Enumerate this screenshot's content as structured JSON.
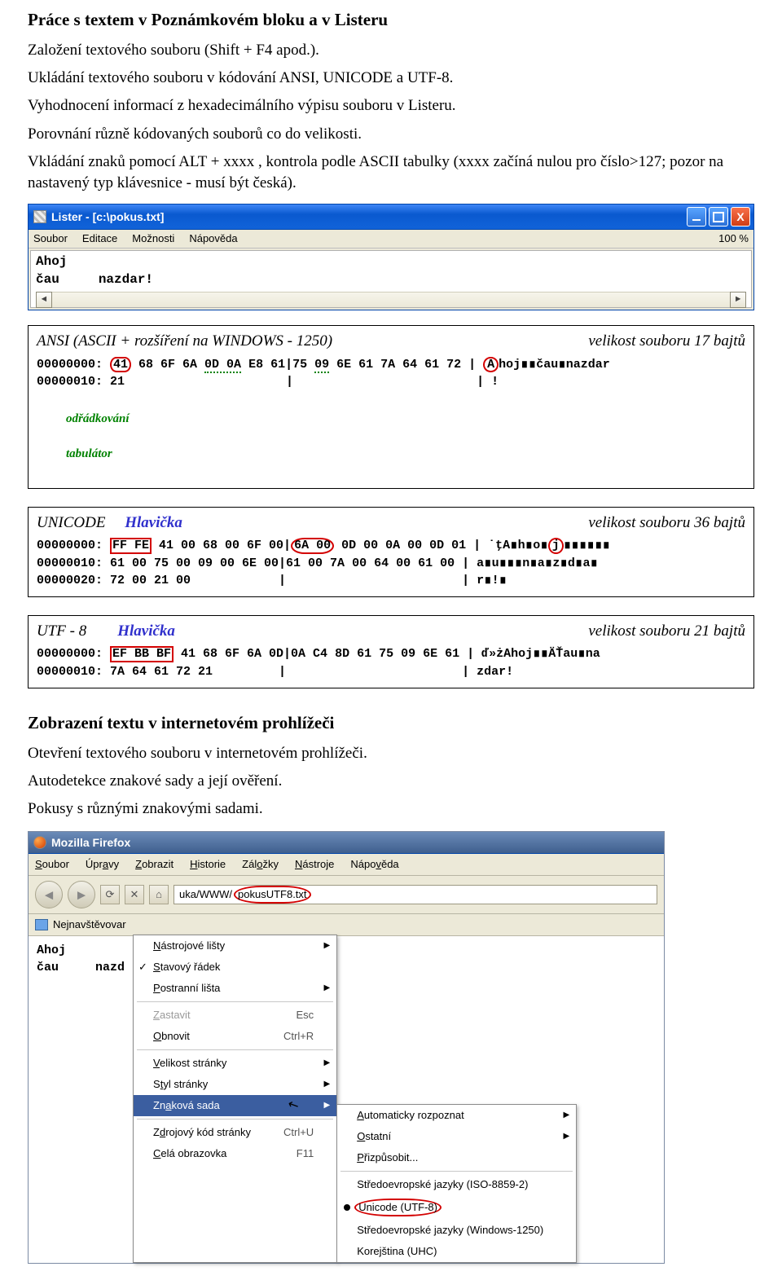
{
  "doc": {
    "heading": "Práce s textem v Poznámkovém bloku a v Listeru",
    "p1": "Založení textového souboru (Shift + F4 apod.).",
    "p2": "Ukládání textového souboru v kódování ANSI, UNICODE a UTF-8.",
    "p3": "Vyhodnocení informací z hexadecimálního výpisu souboru v Listeru.",
    "p4": "Porovnání různě kódovaných souborů co do velikosti.",
    "p5": "Vkládání znaků pomocí ALT + xxxx , kontrola podle ASCII tabulky (xxxx začíná nulou pro číslo>127; pozor na nastavený typ klávesnice - musí být česká).",
    "h2b": "Zobrazení textu v internetovém prohlížeči",
    "p6": "Otevření textového souboru v internetovém prohlížeči.",
    "p7": "Autodetekce znakové sady a její ověření.",
    "p8": "Pokusy s různými znakovými sadami."
  },
  "lister": {
    "title": "Lister - [c:\\pokus.txt]",
    "menu": [
      "Soubor",
      "Editace",
      "Možnosti",
      "Nápověda"
    ],
    "percent": "100 %",
    "line1": "Ahoj",
    "line2": "čau     nazdar!"
  },
  "annot": {
    "odr": "odřádkování",
    "tab": "tabulátor",
    "hlav": "Hlavička"
  },
  "ansi": {
    "title_left": "ANSI (ASCII + rozšíření na WINDOWS - 1250)",
    "title_right": "velikost souboru 17 bajtů",
    "l1_addr": "00000000: ",
    "l1_41": "41",
    "l1_a": " 68 6F 6A ",
    "l1_odr": "0D 0A",
    "l1_b": " E8 61|75 ",
    "l1_tab": "09",
    "l1_c": " 6E 61 7A 64 61 72 | ",
    "l1_A": "A",
    "l1_txt": "hoj∎∎čau∎nazdar",
    "l2": "00000010: 21                      |                         | !"
  },
  "unicode": {
    "title_left": "UNICODE",
    "title_right": "velikost souboru 36 bajtů",
    "l1_addr": "00000000: ",
    "l1_hdr": "FF FE",
    "l1_a": " 41 00 68 00 6F 00|",
    "l1_mark": "6A 00",
    "l1_b": " 0D 00 0A 00 0D 01 | ˙ţA∎h∎o∎",
    "l1_j": "j",
    "l1_c": "∎∎∎∎∎∎",
    "l2": "00000010: 61 00 75 00 09 00 6E 00|61 00 7A 00 64 00 61 00 | a∎u∎∎∎n∎a∎z∎d∎a∎",
    "l3": "00000020: 72 00 21 00            |                        | r∎!∎"
  },
  "utf8": {
    "title_left": "UTF - 8",
    "title_right": "velikost souboru 21 bajtů",
    "l1_addr": "00000000: ",
    "l1_hdr": "EF BB BF",
    "l1_rest": " 41 68 6F 6A 0D|0A C4 8D 61 75 09 6E 61 | ď»żAhoj∎∎ÄŤau∎na",
    "l2": "00000010: 7A 64 61 72 21         |                        | zdar!"
  },
  "ff": {
    "title": "Mozilla Firefox",
    "menu": [
      "Soubor",
      "Úpravy",
      "Zobrazit",
      "Historie",
      "Záložky",
      "Nástroje",
      "Nápověda"
    ],
    "url_plain": "uka/WWW/",
    "url_red": "pokusUTF8.txt",
    "bookmarks": "Nejnavštěvovar",
    "body1": "Ahoj",
    "body2": "čau     nazd"
  },
  "menu1": {
    "items": [
      {
        "t": "Nástrojové lišty",
        "u": "N",
        "sub": true
      },
      {
        "t": "Stavový řádek",
        "u": "S",
        "check": true
      },
      {
        "t": "Postranní lišta",
        "u": "P",
        "sub": true
      },
      {
        "sep": true
      },
      {
        "t": "Zastavit",
        "u": "Z",
        "sc": "Esc",
        "dis": true
      },
      {
        "t": "Obnovit",
        "u": "O",
        "sc": "Ctrl+R"
      },
      {
        "sep": true
      },
      {
        "t": "Velikost stránky",
        "u": "V",
        "sub": true
      },
      {
        "t": "Styl stránky",
        "u": "t",
        "sub": true
      },
      {
        "t": "Znaková sada",
        "u": "a",
        "sub": true,
        "hl": true,
        "cursor": true
      },
      {
        "sep": true
      },
      {
        "t": "Zdrojový kód stránky",
        "u": "d",
        "sc": "Ctrl+U"
      },
      {
        "t": "Celá obrazovka",
        "u": "C",
        "sc": "F11"
      }
    ]
  },
  "menu2": {
    "items": [
      {
        "t": "Automaticky rozpoznat",
        "u": "A",
        "sub": true
      },
      {
        "t": "Ostatní",
        "u": "O",
        "sub": true
      },
      {
        "t": "Přizpůsobit...",
        "u": "P"
      },
      {
        "sep": true
      },
      {
        "t": "Středoevropské jazyky (ISO-8859-2)"
      },
      {
        "t": "Unicode (UTF-8)",
        "bullet": true,
        "red": true
      },
      {
        "t": "Středoevropské jazyky (Windows-1250)"
      },
      {
        "t": "Korejština (UHC)"
      }
    ]
  }
}
